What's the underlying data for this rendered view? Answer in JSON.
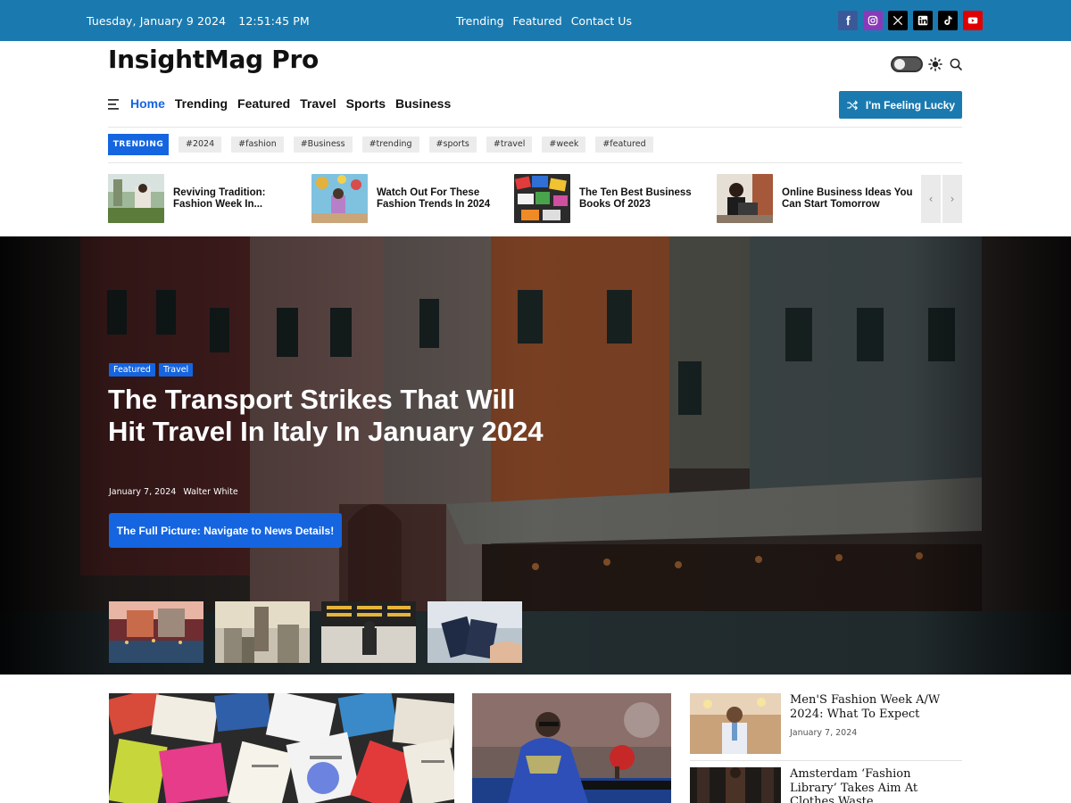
{
  "topbar": {
    "date": "Tuesday, January 9 2024",
    "time": "12:51:45 PM",
    "links": [
      "Trending",
      "Featured",
      "Contact Us"
    ],
    "socials": [
      {
        "name": "facebook-icon",
        "color": "#3b5998"
      },
      {
        "name": "instagram-icon",
        "color": "#8a3ab9"
      },
      {
        "name": "x-icon",
        "color": "#000000"
      },
      {
        "name": "linkedin-icon",
        "color": "#0a66c2"
      },
      {
        "name": "tiktok-icon",
        "color": "#000000"
      },
      {
        "name": "youtube-icon",
        "color": "#e00000"
      }
    ]
  },
  "header": {
    "logo": "InsightMag Pro",
    "nav": [
      "Home",
      "Trending",
      "Featured",
      "Travel",
      "Sports",
      "Business"
    ],
    "active_nav": "Home",
    "lucky_button": "I'm Feeling Lucky"
  },
  "trending": {
    "label": "TRENDING",
    "tags": [
      "#2024",
      "#fashion",
      "#Business",
      "#trending",
      "#sports",
      "#travel",
      "#week",
      "#featured"
    ]
  },
  "ticker": [
    {
      "title": "Reviving Tradition: Fashion Week In..."
    },
    {
      "title": "Watch Out For These Fashion Trends In 2024"
    },
    {
      "title": "The Ten Best Business Books Of 2023"
    },
    {
      "title": "Online Business Ideas You Can Start Tomorrow"
    }
  ],
  "ticker_arrows": {
    "prev": "‹",
    "next": "›"
  },
  "hero": {
    "categories": [
      "Featured",
      "Travel"
    ],
    "title": "The Transport Strikes That Will Hit Travel In Italy In January 2024",
    "date": "January 7, 2024",
    "author": "Walter White",
    "button": "The Full Picture: Navigate to News Details!"
  },
  "side_posts": [
    {
      "title": "Men'S Fashion Week A/W 2024: What To Expect",
      "date": "January 7, 2024"
    },
    {
      "title": "Amsterdam ‘Fashion Library’ Takes Aim At Clothes Waste",
      "date": ""
    }
  ],
  "colors": {
    "brand_blue": "#1a7ab0",
    "accent_blue": "#1565e0"
  }
}
